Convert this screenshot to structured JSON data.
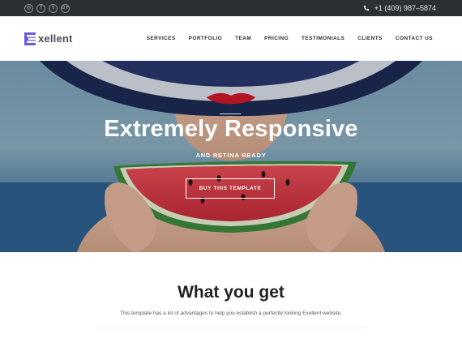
{
  "topbar": {
    "social": [
      {
        "icon": "instagram-icon",
        "glyph": "◎"
      },
      {
        "icon": "facebook-icon",
        "glyph": "f"
      },
      {
        "icon": "twitter-icon",
        "glyph": "t"
      },
      {
        "icon": "google-plus-icon",
        "glyph": "G+"
      }
    ],
    "phone": "+1 (409) 987–5874"
  },
  "header": {
    "logo_text": "xellent",
    "nav": [
      "SERVICES",
      "PORTFOLIO",
      "TEAM",
      "PRICING",
      "TESTIMONIALS",
      "CLIENTS",
      "CONTACT US"
    ]
  },
  "hero": {
    "title": "Extremely Responsive",
    "subtitle": "AND RETINA READY",
    "button": "BUY THIS TEMPLATE"
  },
  "section": {
    "title": "What you get",
    "text": "This template has a lot of advantages to help you establish a perfectly looking Exellent website."
  },
  "colors": {
    "topbar": "#2c2f34",
    "accent": "#6b5bd6",
    "white": "#ffffff"
  }
}
